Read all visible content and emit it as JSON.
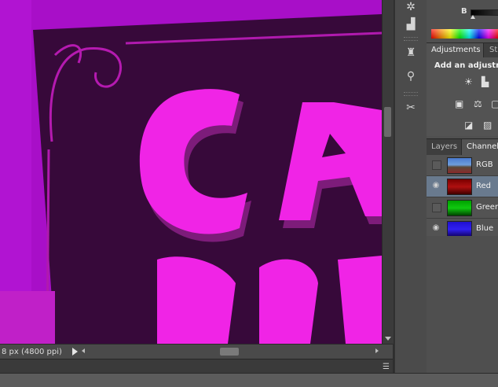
{
  "status": {
    "text": "8 px (4800 ppi)"
  },
  "color_panel": {
    "channel_label": "B"
  },
  "adjustments": {
    "tabs": [
      "Adjustments",
      "St"
    ],
    "hint": "Add an adjustme"
  },
  "layers_panel": {
    "tabs": [
      "Layers",
      "Channels"
    ],
    "channels": [
      {
        "label": "RGB",
        "visible": false
      },
      {
        "label": "Red",
        "visible": true,
        "selected": true
      },
      {
        "label": "Green",
        "visible": false
      },
      {
        "label": "Blue",
        "visible": true
      }
    ]
  },
  "canvas": {
    "text": "CA"
  },
  "colors": {
    "canvas_bg": "#a70fc6",
    "sign_dark": "#3a0a3a",
    "letters": "#f022e6",
    "selection": "#697a8e"
  }
}
